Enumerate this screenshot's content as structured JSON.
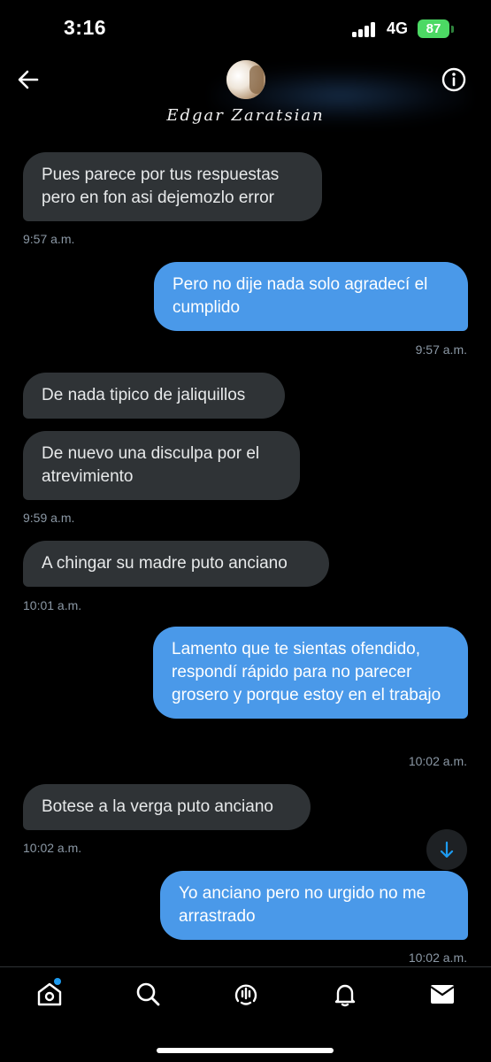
{
  "status_bar": {
    "time": "3:16",
    "network": "4G",
    "battery": "87"
  },
  "header": {
    "contact_name": "Edgar Zaratsian",
    "back_icon": "arrow-left-icon",
    "info_icon": "info-circle-icon"
  },
  "messages": [
    {
      "side": "in",
      "text": "Pues parece por tus respuestas pero en fon asi dejemozlo error",
      "time": "9:57 a.m."
    },
    {
      "side": "out",
      "text": "Pero no dije nada solo agradecí el cumplido",
      "time": "9:57 a.m."
    },
    {
      "side": "in",
      "text": "De nada tipico de jaliquillos",
      "time": ""
    },
    {
      "side": "in",
      "text": "De nuevo una disculpa por el atrevimiento",
      "time": "9:59 a.m."
    },
    {
      "side": "in",
      "text": "A chingar su madre puto anciano",
      "time": "10:01 a.m."
    },
    {
      "side": "out",
      "text": "Lamento que te sientas ofendido, respondí rápido para no parecer grosero y porque estoy en el trabajo",
      "time": "10:02 a.m."
    },
    {
      "side": "in",
      "text": "Botese a la verga puto anciano",
      "time": "10:02 a.m."
    },
    {
      "side": "out",
      "text": "Yo anciano pero no urgido no me arrastrado",
      "time": "10:02 a.m."
    }
  ],
  "tabbar": {
    "items": [
      "home-icon",
      "search-icon",
      "spaces-icon",
      "notifications-icon",
      "messages-icon"
    ]
  },
  "colors": {
    "incoming_bubble": "#2f3336",
    "outgoing_bubble": "#4a99e9",
    "battery": "#4cd964",
    "accent": "#1d9bf0"
  }
}
